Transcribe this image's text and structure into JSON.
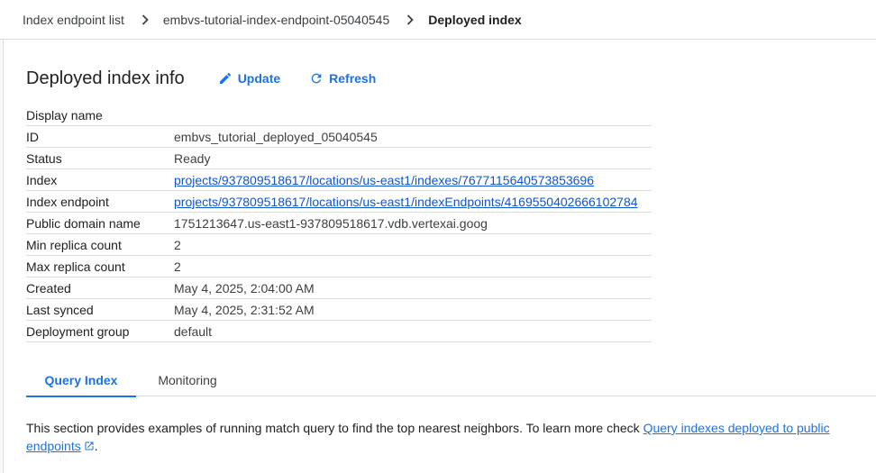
{
  "breadcrumb": {
    "items": [
      "Index endpoint list",
      "embvs-tutorial-index-endpoint-05040545",
      "Deployed index"
    ]
  },
  "header": {
    "title": "Deployed index info",
    "update_label": "Update",
    "refresh_label": "Refresh"
  },
  "info": {
    "rows": [
      {
        "label": "Display name",
        "value": ""
      },
      {
        "label": "ID",
        "value": "embvs_tutorial_deployed_05040545"
      },
      {
        "label": "Status",
        "value": "Ready"
      },
      {
        "label": "Index",
        "value": "projects/937809518617/locations/us-east1/indexes/7677115640573853696"
      },
      {
        "label": "Index endpoint",
        "value": "projects/937809518617/locations/us-east1/indexEndpoints/4169550402666102784"
      },
      {
        "label": "Public domain name",
        "value": "1751213647.us-east1-937809518617.vdb.vertexai.goog"
      },
      {
        "label": "Min replica count",
        "value": "2"
      },
      {
        "label": "Max replica count",
        "value": "2"
      },
      {
        "label": "Created",
        "value": "May 4, 2025, 2:04:00 AM"
      },
      {
        "label": "Last synced",
        "value": "May 4, 2025, 2:31:52 AM"
      },
      {
        "label": "Deployment group",
        "value": "default"
      }
    ]
  },
  "tabs": [
    "Query Index",
    "Monitoring"
  ],
  "description": {
    "text": "This section provides examples of running match query to find the top nearest neighbors. To learn more check ",
    "link_text": "Query indexes deployed to public endpoints",
    "suffix": "."
  },
  "colors": {
    "accent": "#1a73e8",
    "divider": "#dadce0"
  }
}
